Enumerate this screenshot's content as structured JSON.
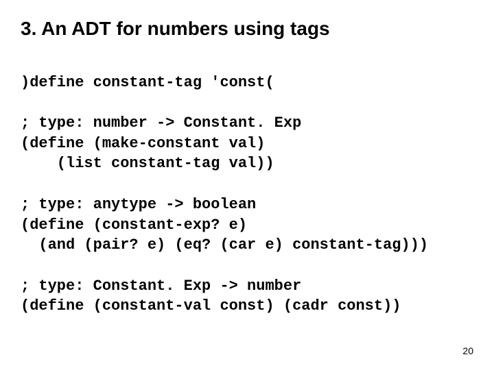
{
  "title": "3. An ADT for numbers using tags",
  "lines": {
    "l1": ")define constant-tag 'const(",
    "l2": "",
    "l3": "; type: number -> Constant. Exp",
    "l4": "(define (make-constant val)",
    "l5": "    (list constant-tag val))",
    "l6": "",
    "l7": "; type: anytype -> boolean",
    "l8": "(define (constant-exp? e)",
    "l9": "  (and (pair? e) (eq? (car e) constant-tag)))",
    "l10": "",
    "l11": "; type: Constant. Exp -> number",
    "l12": "(define (constant-val const) (cadr const))"
  },
  "page_number": "20"
}
